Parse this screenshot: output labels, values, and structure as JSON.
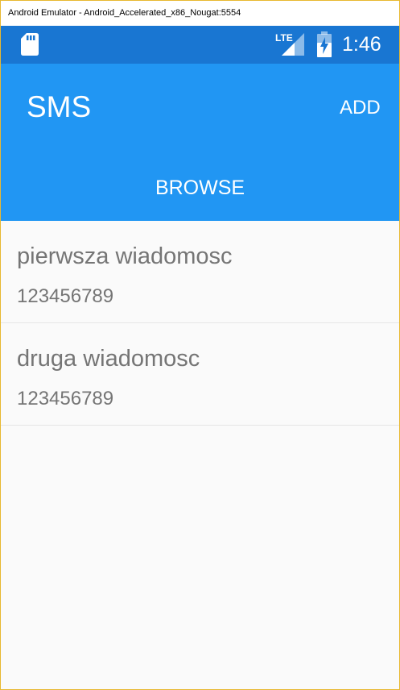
{
  "window": {
    "title": "Android Emulator - Android_Accelerated_x86_Nougat:5554"
  },
  "status_bar": {
    "network_type": "LTE",
    "time": "1:46",
    "icons": [
      "sd-card-icon",
      "lte-signal-icon",
      "battery-charging-icon"
    ],
    "color": "#1976d2"
  },
  "app_bar": {
    "title": "SMS",
    "add_label": "ADD",
    "tab_label": "BROWSE",
    "color": "#2196f3"
  },
  "messages": [
    {
      "title": "pierwsza wiadomosc",
      "number": "123456789"
    },
    {
      "title": "druga wiadomosc",
      "number": "123456789"
    }
  ]
}
